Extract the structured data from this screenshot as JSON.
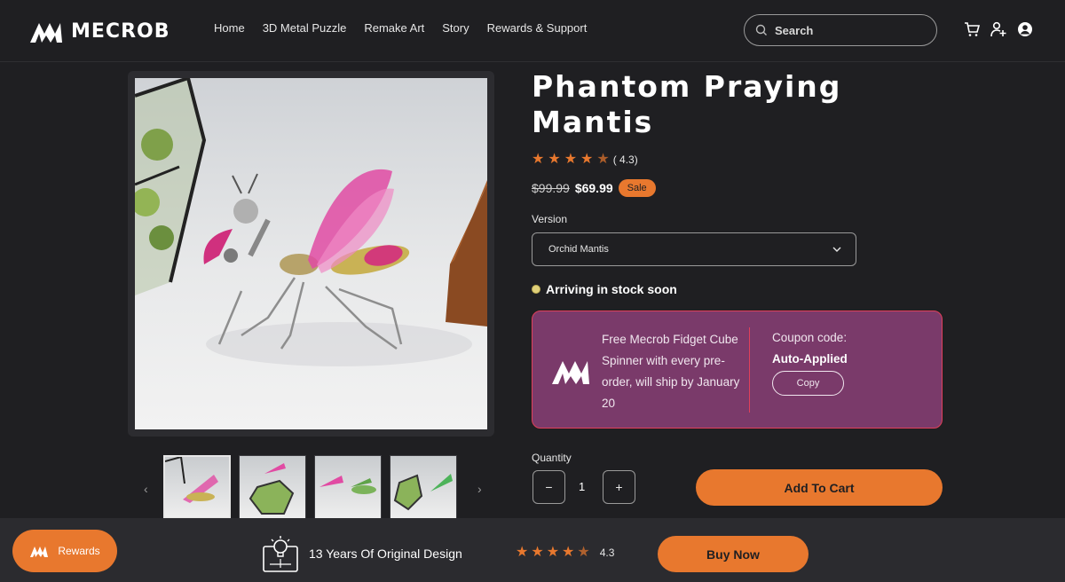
{
  "brand": {
    "name": "MECROB",
    "logo_icon": "mecrob-logo-icon"
  },
  "nav": {
    "items": [
      {
        "label": "Home"
      },
      {
        "label": "3D Metal Puzzle"
      },
      {
        "label": "Remake Art"
      },
      {
        "label": "Story"
      },
      {
        "label": "Rewards & Support"
      }
    ]
  },
  "search": {
    "placeholder": "Search",
    "icon": "search-icon"
  },
  "header_icons": [
    "cart-icon",
    "add-user-icon",
    "account-icon"
  ],
  "product": {
    "title": "Phantom Praying Mantis",
    "rating": 4.3,
    "rating_text": "( 4.3)",
    "original_price": "$99.99",
    "price": "$69.99",
    "badge": "Sale",
    "version_label": "Version",
    "version_selected": "Orchid Mantis",
    "status": "Arriving in stock soon"
  },
  "promo": {
    "text": "Free Mecrob Fidget Cube Spinner with every pre-order, will ship by January 20",
    "coupon_label": "Coupon code:",
    "coupon_value": "Auto-Applied",
    "copy_label": "Copy"
  },
  "quantity": {
    "label": "Quantity",
    "value": "1",
    "decrement": "−",
    "increment": "+"
  },
  "add_to_cart": "Add To Cart",
  "bottom_bar": {
    "rewards_label": "Rewards",
    "design_text": "13 Years Of Original Design",
    "rating_text": "4.3",
    "buy_now": "Buy Now"
  },
  "colors": {
    "accent": "#e8782e",
    "background": "#1f1f22",
    "promo_bg": "#7a3a6a",
    "promo_border": "#e0405a"
  }
}
